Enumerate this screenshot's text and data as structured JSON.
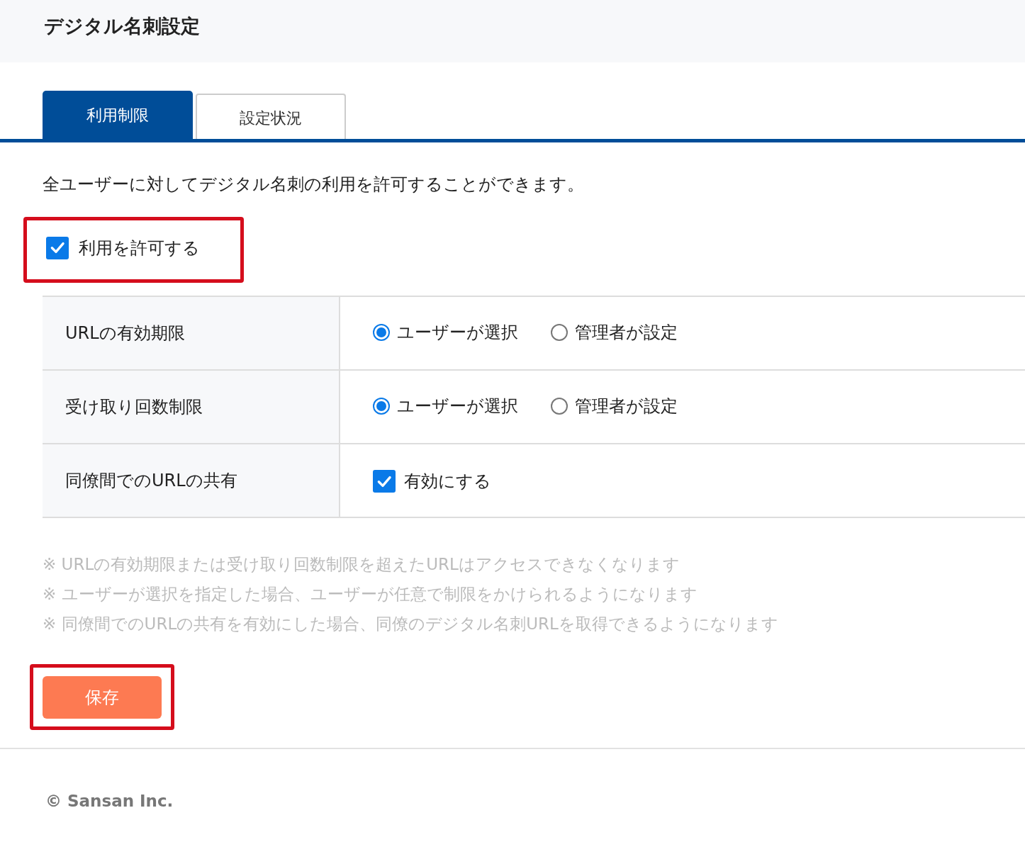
{
  "header": {
    "title": "デジタル名刺設定"
  },
  "tabs": [
    {
      "label": "利用制限",
      "selected": true
    },
    {
      "label": "設定状況",
      "selected": false
    }
  ],
  "description": "全ユーザーに対してデジタル名刺の利用を許可することができます。",
  "allow": {
    "label": "利用を許可する",
    "checked": true,
    "highlighted": true
  },
  "settings": [
    {
      "label": "URLの有効期限",
      "kind": "radio",
      "options": [
        {
          "label": "ユーザーが選択",
          "selected": true
        },
        {
          "label": "管理者が設定",
          "selected": false
        }
      ]
    },
    {
      "label": "受け取り回数制限",
      "kind": "radio",
      "options": [
        {
          "label": "ユーザーが選択",
          "selected": true
        },
        {
          "label": "管理者が設定",
          "selected": false
        }
      ]
    },
    {
      "label": "同僚間でのURLの共有",
      "kind": "checkbox",
      "checkbox": {
        "label": "有効にする",
        "checked": true
      }
    }
  ],
  "notes": [
    "※ URLの有効期限または受け取り回数制限を超えたURLはアクセスできなくなります",
    "※ ユーザーが選択を指定した場合、ユーザーが任意で制限をかけられるようになります",
    "※ 同僚間でのURLの共有を有効にした場合、同僚のデジタル名刺URLを取得できるようになります"
  ],
  "save_button": {
    "label": "保存",
    "highlighted": true
  },
  "footer": "© Sansan Inc."
}
